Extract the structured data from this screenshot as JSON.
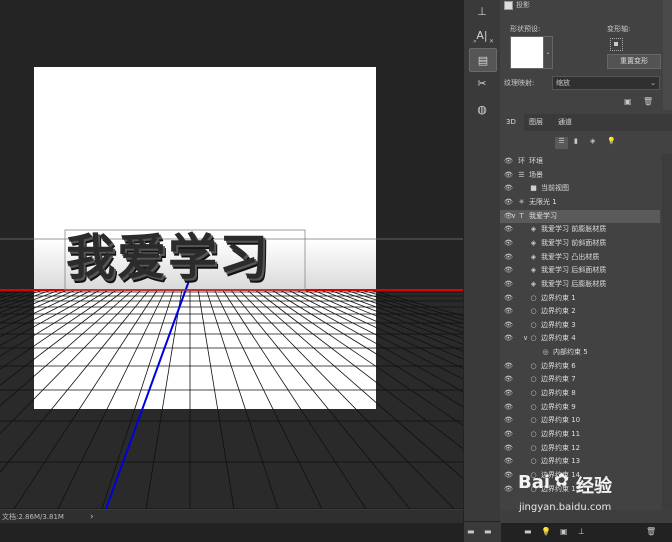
{
  "canvas": {
    "artwork_text": "我爱学习"
  },
  "status": {
    "doc_info": "文档:2.86M/3.81M",
    "arrow": "›"
  },
  "properties": {
    "shadow_label": "投影",
    "shape_preset_label": "形状预设:",
    "deform_axis_label": "变形轴:",
    "reset_deform_button": "重置变形",
    "texture_map_label": "纹理映射:",
    "texture_map_value": "缩放"
  },
  "panel_tabs": [
    "3D",
    "图层",
    "通道"
  ],
  "layers": [
    {
      "icon": "环",
      "label": "环境",
      "indent": 0,
      "eye": true,
      "twist": ""
    },
    {
      "icon": "☰",
      "label": "场景",
      "indent": 0,
      "eye": true,
      "twist": ""
    },
    {
      "icon": "■",
      "label": "当前视图",
      "indent": 1,
      "eye": true,
      "twist": ""
    },
    {
      "icon": "✳",
      "label": "无限光 1",
      "indent": 0,
      "eye": true,
      "twist": ""
    },
    {
      "icon": "T",
      "label": "我爱学习",
      "indent": 0,
      "eye": true,
      "twist": "∨",
      "selected": true
    },
    {
      "icon": "◈",
      "label": "我爱学习 前膨胀材质",
      "indent": 1,
      "eye": true,
      "twist": ""
    },
    {
      "icon": "◈",
      "label": "我爱学习 前斜面材质",
      "indent": 1,
      "eye": true,
      "twist": ""
    },
    {
      "icon": "◈",
      "label": "我爱学习 凸出材质",
      "indent": 1,
      "eye": true,
      "twist": ""
    },
    {
      "icon": "◈",
      "label": "我爱学习 后斜面材质",
      "indent": 1,
      "eye": true,
      "twist": ""
    },
    {
      "icon": "◈",
      "label": "我爱学习 后膨胀材质",
      "indent": 1,
      "eye": true,
      "twist": ""
    },
    {
      "icon": "○",
      "label": "边界约束 1",
      "indent": 1,
      "eye": true,
      "twist": ""
    },
    {
      "icon": "○",
      "label": "边界约束 2",
      "indent": 1,
      "eye": true,
      "twist": ""
    },
    {
      "icon": "○",
      "label": "边界约束 3",
      "indent": 1,
      "eye": true,
      "twist": ""
    },
    {
      "icon": "○",
      "label": "边界约束 4",
      "indent": 1,
      "eye": true,
      "twist": "∨"
    },
    {
      "icon": "◎",
      "label": "内部约束 5",
      "indent": 2,
      "eye": false,
      "twist": ""
    },
    {
      "icon": "○",
      "label": "边界约束 6",
      "indent": 1,
      "eye": true,
      "twist": ""
    },
    {
      "icon": "○",
      "label": "边界约束 7",
      "indent": 1,
      "eye": true,
      "twist": ""
    },
    {
      "icon": "○",
      "label": "边界约束 8",
      "indent": 1,
      "eye": true,
      "twist": ""
    },
    {
      "icon": "○",
      "label": "边界约束 9",
      "indent": 1,
      "eye": true,
      "twist": ""
    },
    {
      "icon": "○",
      "label": "边界约束 10",
      "indent": 1,
      "eye": true,
      "twist": ""
    },
    {
      "icon": "○",
      "label": "边界约束 11",
      "indent": 1,
      "eye": true,
      "twist": ""
    },
    {
      "icon": "○",
      "label": "边界约束 12",
      "indent": 1,
      "eye": true,
      "twist": ""
    },
    {
      "icon": "○",
      "label": "边界约束 13",
      "indent": 1,
      "eye": true,
      "twist": ""
    },
    {
      "icon": "○",
      "label": "边界约束 14",
      "indent": 1,
      "eye": true,
      "twist": ""
    },
    {
      "icon": "○",
      "label": "边界约束 15",
      "indent": 1,
      "eye": true,
      "twist": ""
    }
  ],
  "watermark": {
    "brand": "Bai",
    "brand2": "经验",
    "url": "jingyan.baidu.com"
  },
  "colors": {
    "app_bg": "#1e1e1e",
    "panel_bg": "#424242",
    "ground_line": "#e00000",
    "axis_line": "#0000e0"
  }
}
